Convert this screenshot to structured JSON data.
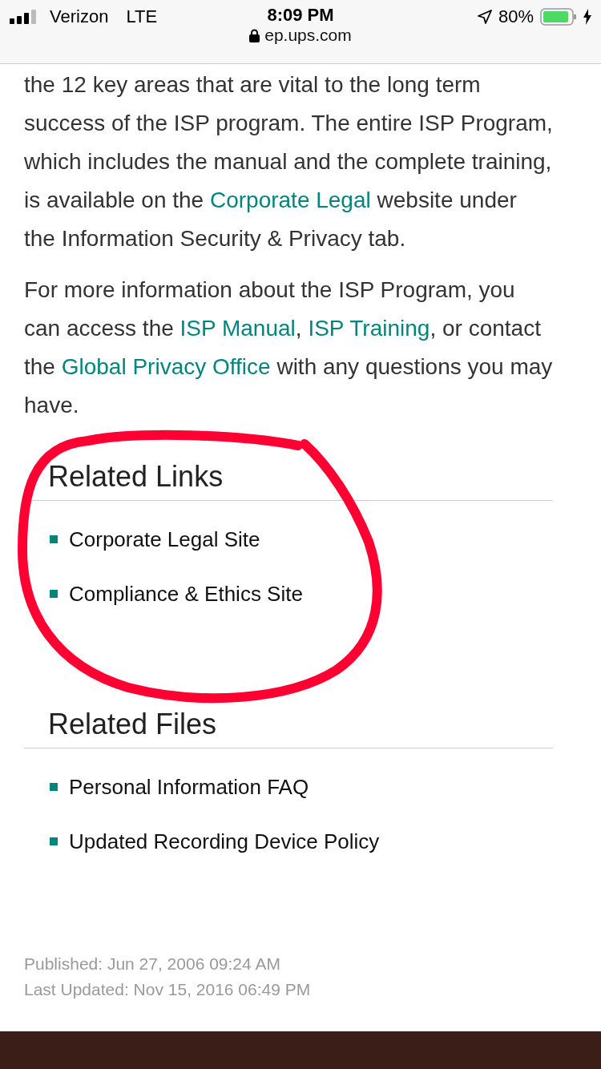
{
  "status_bar": {
    "carrier": "Verizon",
    "network": "LTE",
    "time": "8:09 PM",
    "url": "ep.ups.com",
    "battery": "80%"
  },
  "paragraphs": [
    {
      "segments": [
        {
          "kind": "text",
          "text": "the 12 key areas that are vital to the long term success of the ISP program. The entire ISP Program, which includes the manual and the complete training, is available on the "
        },
        {
          "kind": "link",
          "text": "Corporate Legal"
        },
        {
          "kind": "text",
          "text": " website under the Information Security & Privacy tab."
        }
      ]
    },
    {
      "segments": [
        {
          "kind": "text",
          "text": "For more information about the ISP Program, you can access the "
        },
        {
          "kind": "link",
          "text": "ISP Manual"
        },
        {
          "kind": "text",
          "text": ", "
        },
        {
          "kind": "link",
          "text": "ISP Training"
        },
        {
          "kind": "text",
          "text": ", or contact the "
        },
        {
          "kind": "link",
          "text": "Global Privacy Office"
        },
        {
          "kind": "text",
          "text": " with any questions you may have."
        }
      ]
    }
  ],
  "sections": [
    {
      "title": "Related Links",
      "items": [
        "Corporate Legal Site",
        "Compliance & Ethics Site"
      ]
    },
    {
      "title": "Related Files",
      "items": [
        "Personal Information FAQ",
        "Updated Recording Device Policy"
      ]
    }
  ],
  "footer": [
    "Published: Jun 27, 2006 09:24 AM",
    "Last Updated: Nov 15, 2016 06:49 PM"
  ]
}
